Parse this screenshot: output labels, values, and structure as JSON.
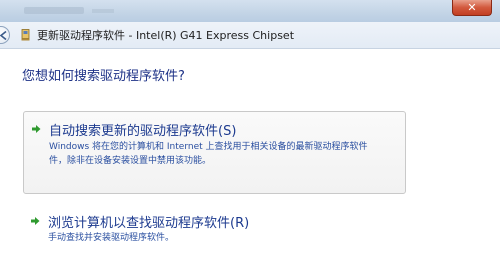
{
  "window": {
    "title": "更新驱动程序软件 - Intel(R) G41 Express Chipset",
    "close_label": "✕"
  },
  "content": {
    "question": "您想如何搜索驱动程序软件?",
    "options": [
      {
        "title": "自动搜索更新的驱动程序软件(S)",
        "description_line1": "Windows 将在您的计算机和 Internet 上查找用于相关设备的最新驱动程序软件",
        "description_line2": "件，除非在设备安装设置中禁用该功能。"
      },
      {
        "title": "浏览计算机以查找驱动程序软件(R)",
        "description_line1": "手动查找并安装驱动程序软件。"
      }
    ]
  },
  "colors": {
    "arrow_green": "#2f9a2f",
    "title_blue": "#1c3a8f",
    "close_red": "#c23f22"
  },
  "icons": {
    "back": "back-arrow-icon",
    "device": "device-driver-icon",
    "option_arrow": "green-arrow-icon"
  }
}
